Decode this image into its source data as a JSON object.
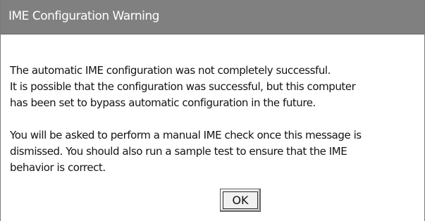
{
  "dialog": {
    "title": "IME Configuration Warning",
    "paragraph1": [
      "The automatic IME configuration was not completely successful.",
      "It is possible that the configuration was successful, but this computer",
      "has been set to bypass automatic configuration in the future."
    ],
    "paragraph2": [
      "You will be asked to perform a manual IME check once this message is",
      "dismissed. You should also run a sample test to ensure that the IME",
      "behavior is correct."
    ],
    "ok_label": "OK"
  }
}
